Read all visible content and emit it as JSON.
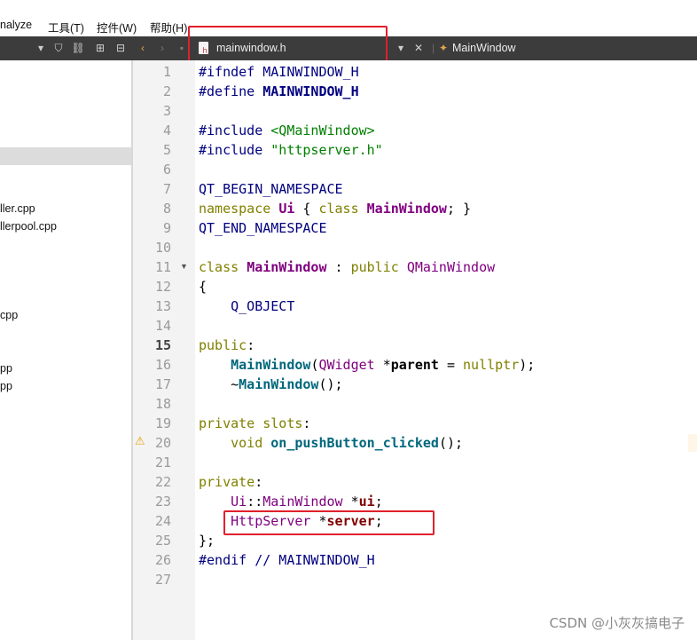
{
  "menubar": {
    "items": [
      {
        "label": "nalyze"
      },
      {
        "label": "工具(T)"
      },
      {
        "label": "控件(W)"
      },
      {
        "label": "帮助(H)"
      }
    ]
  },
  "editor": {
    "open_file": "mainwindow.h",
    "symbol": "MainWindow"
  },
  "sidebar": {
    "files": [
      "ller.cpp",
      "llerpool.cpp",
      "cpp",
      "pp",
      "pp"
    ]
  },
  "code": {
    "line_numbers": [
      "1",
      "2",
      "3",
      "4",
      "5",
      "6",
      "7",
      "8",
      "9",
      "10",
      "11",
      "12",
      "13",
      "14",
      "15",
      "16",
      "17",
      "18",
      "19",
      "20",
      "21",
      "22",
      "23",
      "24",
      "25",
      "26",
      "27"
    ],
    "current_line": "15"
  },
  "watermark": "CSDN @小灰灰搞电子",
  "colors": {
    "highlight_box": "#e0202c",
    "toolbar_bg": "#3c3c3c"
  }
}
